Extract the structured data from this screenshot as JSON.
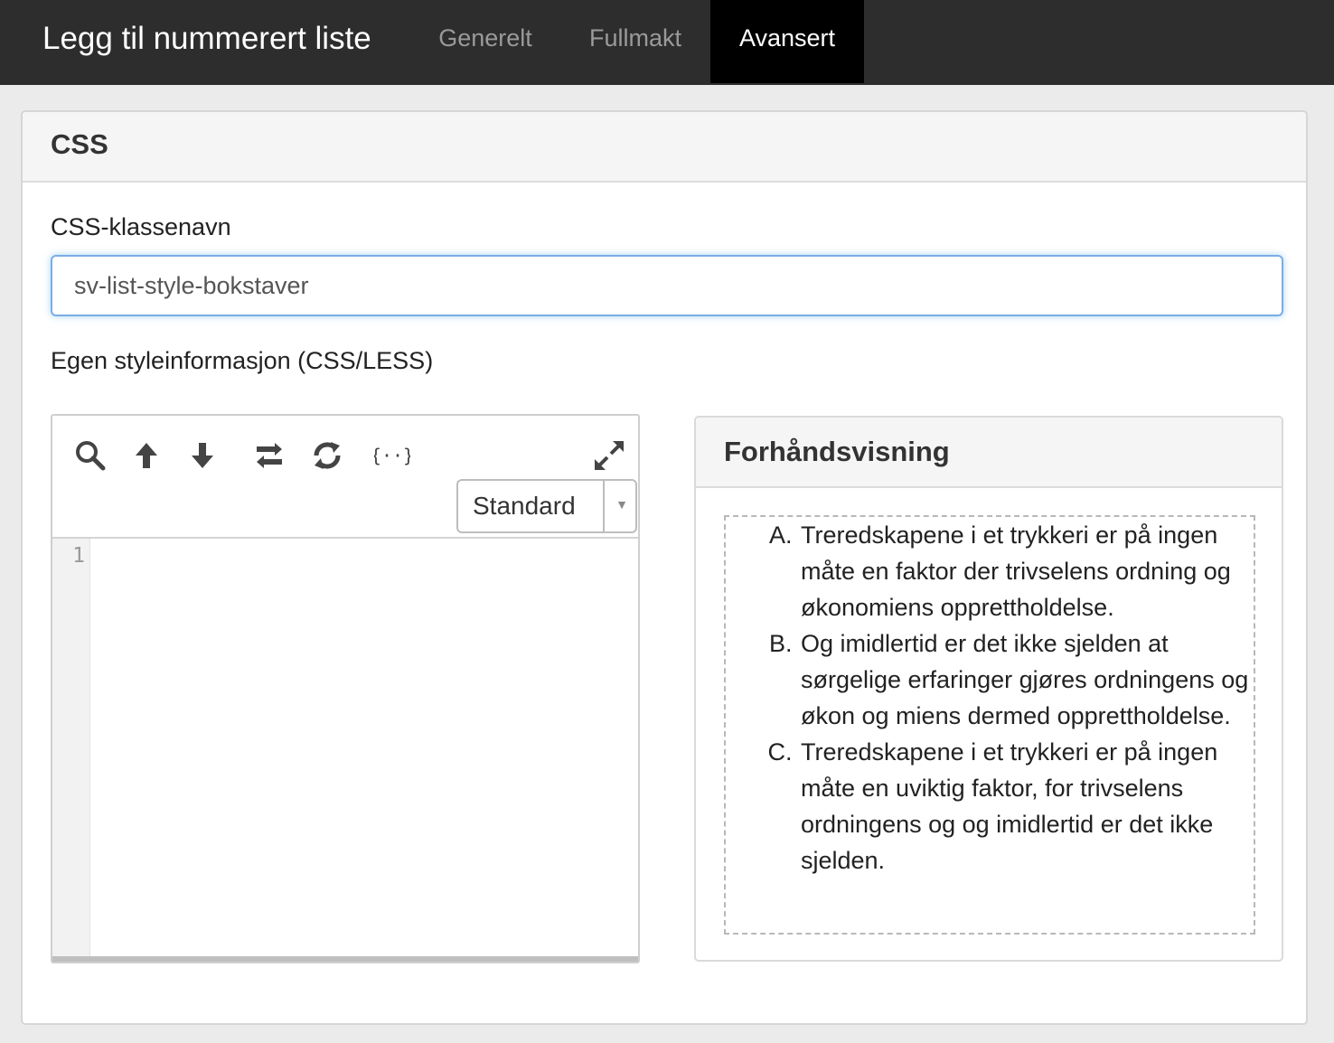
{
  "header": {
    "title": "Legg til nummerert liste",
    "tabs": [
      {
        "label": "Generelt",
        "active": false
      },
      {
        "label": "Fullmakt",
        "active": false
      },
      {
        "label": "Avansert",
        "active": true
      }
    ]
  },
  "css_section": {
    "title": "CSS",
    "class_name_label": "CSS-klassenavn",
    "class_name_value": "sv-list-style-bokstaver",
    "style_label": "Egen styleinformasjon (CSS/LESS)"
  },
  "editor": {
    "toolbar_icons": [
      "search-icon",
      "arrow-up-icon",
      "arrow-down-icon",
      "replace-icon",
      "refresh-icon",
      "format-braces-icon",
      "expand-icon"
    ],
    "mode": "Standard",
    "line_numbers": [
      "1"
    ]
  },
  "preview": {
    "title": "Forhåndsvisning",
    "items": [
      "Treredskapene i et trykkeri er på ingen måte en faktor der trivselens ordning og økonomiens opprettholdelse.",
      "Og imidlertid er det ikke sjelden at sørgelige erfaringer gjøres ordningens og økon og miens dermed opprettholdelse.",
      "Treredskapene i et trykkeri er på ingen måte en uviktig faktor, for trivselens ordningens og og imidlertid er det ikke sjelden."
    ]
  },
  "colors": {
    "topbar_bg": "#2d2d2d",
    "active_tab_bg": "#000000",
    "input_focus_border": "#79aee6"
  }
}
